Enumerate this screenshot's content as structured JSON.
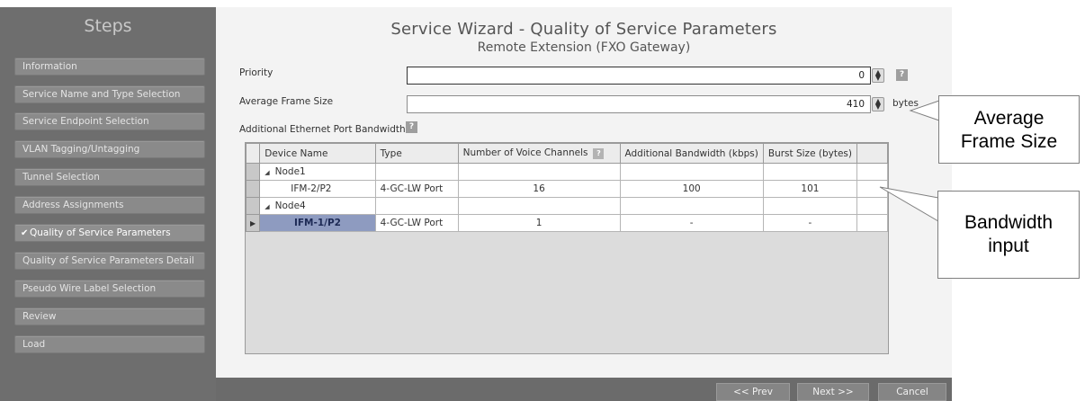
{
  "sidebar": {
    "title": "Steps",
    "items": [
      {
        "label": "Information"
      },
      {
        "label": "Service Name and Type Selection"
      },
      {
        "label": "Service Endpoint Selection"
      },
      {
        "label": "VLAN Tagging/Untagging"
      },
      {
        "label": "Tunnel Selection"
      },
      {
        "label": "Address Assignments"
      },
      {
        "label": "Quality of Service Parameters",
        "check": "✔"
      },
      {
        "label": "Quality of Service Parameters Detail"
      },
      {
        "label": "Pseudo Wire Label Selection"
      },
      {
        "label": "Review"
      },
      {
        "label": "Load"
      }
    ]
  },
  "main": {
    "title": "Service Wizard - Quality of Service Parameters",
    "subtitle": "Remote Extension (FXO Gateway)",
    "priority": {
      "label": "Priority",
      "value": "0"
    },
    "frame_size": {
      "label": "Average Frame Size",
      "value": "410",
      "unit": "bytes"
    },
    "bandwidth_label": "Additional Ethernet Port Bandwidth",
    "help_glyph": "?",
    "table": {
      "columns": [
        "Device Name",
        "Type",
        "Number of Voice Channels",
        "Additional Bandwidth (kbps)",
        "Burst Size (bytes)"
      ],
      "rows": [
        {
          "name": "Node1",
          "group": true
        },
        {
          "name": "IFM-2/P2",
          "type": "4-GC-LW Port",
          "channels": "16",
          "bandwidth": "100",
          "burst": "101"
        },
        {
          "name": "Node4",
          "group": true
        },
        {
          "name": "IFM-1/P2",
          "type": "4-GC-LW Port",
          "channels": "1",
          "bandwidth": "-",
          "burst": "-",
          "current": true
        }
      ]
    }
  },
  "buttons": {
    "prev": "<< Prev",
    "next": "Next >>",
    "cancel": "Cancel"
  },
  "callouts": {
    "frame_size_line1": "Average",
    "frame_size_line2": "Frame Size",
    "bandwidth_line1": "Bandwidth",
    "bandwidth_line2": "input"
  },
  "colors": {
    "active_cell": "#8e9bc0",
    "chrome": "#6b6b6b"
  }
}
